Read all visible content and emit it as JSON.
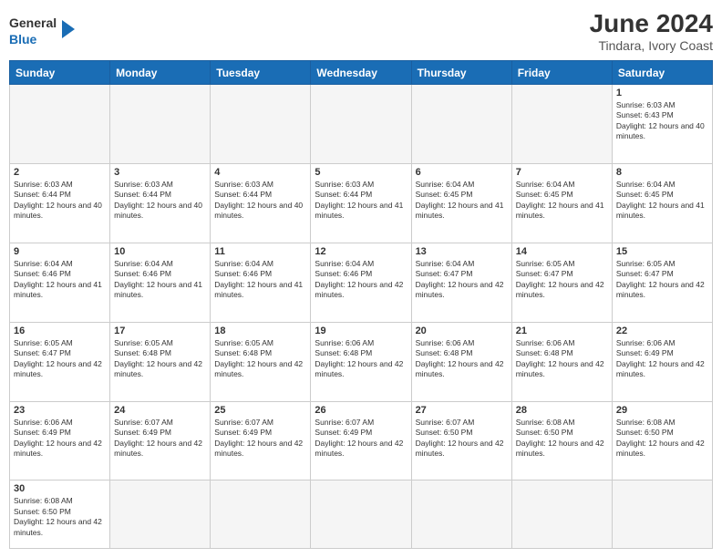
{
  "header": {
    "logo_general": "General",
    "logo_blue": "Blue",
    "month_year": "June 2024",
    "location": "Tindara, Ivory Coast"
  },
  "days_of_week": [
    "Sunday",
    "Monday",
    "Tuesday",
    "Wednesday",
    "Thursday",
    "Friday",
    "Saturday"
  ],
  "weeks": [
    [
      {
        "day": "",
        "empty": true
      },
      {
        "day": "",
        "empty": true
      },
      {
        "day": "",
        "empty": true
      },
      {
        "day": "",
        "empty": true
      },
      {
        "day": "",
        "empty": true
      },
      {
        "day": "",
        "empty": true
      },
      {
        "day": "1",
        "sunrise": "6:03 AM",
        "sunset": "6:43 PM",
        "daylight": "12 hours and 40 minutes."
      }
    ],
    [
      {
        "day": "2",
        "sunrise": "6:03 AM",
        "sunset": "6:44 PM",
        "daylight": "12 hours and 40 minutes."
      },
      {
        "day": "3",
        "sunrise": "6:03 AM",
        "sunset": "6:44 PM",
        "daylight": "12 hours and 40 minutes."
      },
      {
        "day": "4",
        "sunrise": "6:03 AM",
        "sunset": "6:44 PM",
        "daylight": "12 hours and 40 minutes."
      },
      {
        "day": "5",
        "sunrise": "6:03 AM",
        "sunset": "6:44 PM",
        "daylight": "12 hours and 41 minutes."
      },
      {
        "day": "6",
        "sunrise": "6:04 AM",
        "sunset": "6:45 PM",
        "daylight": "12 hours and 41 minutes."
      },
      {
        "day": "7",
        "sunrise": "6:04 AM",
        "sunset": "6:45 PM",
        "daylight": "12 hours and 41 minutes."
      },
      {
        "day": "8",
        "sunrise": "6:04 AM",
        "sunset": "6:45 PM",
        "daylight": "12 hours and 41 minutes."
      }
    ],
    [
      {
        "day": "9",
        "sunrise": "6:04 AM",
        "sunset": "6:46 PM",
        "daylight": "12 hours and 41 minutes."
      },
      {
        "day": "10",
        "sunrise": "6:04 AM",
        "sunset": "6:46 PM",
        "daylight": "12 hours and 41 minutes."
      },
      {
        "day": "11",
        "sunrise": "6:04 AM",
        "sunset": "6:46 PM",
        "daylight": "12 hours and 41 minutes."
      },
      {
        "day": "12",
        "sunrise": "6:04 AM",
        "sunset": "6:46 PM",
        "daylight": "12 hours and 42 minutes."
      },
      {
        "day": "13",
        "sunrise": "6:04 AM",
        "sunset": "6:47 PM",
        "daylight": "12 hours and 42 minutes."
      },
      {
        "day": "14",
        "sunrise": "6:05 AM",
        "sunset": "6:47 PM",
        "daylight": "12 hours and 42 minutes."
      },
      {
        "day": "15",
        "sunrise": "6:05 AM",
        "sunset": "6:47 PM",
        "daylight": "12 hours and 42 minutes."
      }
    ],
    [
      {
        "day": "16",
        "sunrise": "6:05 AM",
        "sunset": "6:47 PM",
        "daylight": "12 hours and 42 minutes."
      },
      {
        "day": "17",
        "sunrise": "6:05 AM",
        "sunset": "6:48 PM",
        "daylight": "12 hours and 42 minutes."
      },
      {
        "day": "18",
        "sunrise": "6:05 AM",
        "sunset": "6:48 PM",
        "daylight": "12 hours and 42 minutes."
      },
      {
        "day": "19",
        "sunrise": "6:06 AM",
        "sunset": "6:48 PM",
        "daylight": "12 hours and 42 minutes."
      },
      {
        "day": "20",
        "sunrise": "6:06 AM",
        "sunset": "6:48 PM",
        "daylight": "12 hours and 42 minutes."
      },
      {
        "day": "21",
        "sunrise": "6:06 AM",
        "sunset": "6:48 PM",
        "daylight": "12 hours and 42 minutes."
      },
      {
        "day": "22",
        "sunrise": "6:06 AM",
        "sunset": "6:49 PM",
        "daylight": "12 hours and 42 minutes."
      }
    ],
    [
      {
        "day": "23",
        "sunrise": "6:06 AM",
        "sunset": "6:49 PM",
        "daylight": "12 hours and 42 minutes."
      },
      {
        "day": "24",
        "sunrise": "6:07 AM",
        "sunset": "6:49 PM",
        "daylight": "12 hours and 42 minutes."
      },
      {
        "day": "25",
        "sunrise": "6:07 AM",
        "sunset": "6:49 PM",
        "daylight": "12 hours and 42 minutes."
      },
      {
        "day": "26",
        "sunrise": "6:07 AM",
        "sunset": "6:49 PM",
        "daylight": "12 hours and 42 minutes."
      },
      {
        "day": "27",
        "sunrise": "6:07 AM",
        "sunset": "6:50 PM",
        "daylight": "12 hours and 42 minutes."
      },
      {
        "day": "28",
        "sunrise": "6:08 AM",
        "sunset": "6:50 PM",
        "daylight": "12 hours and 42 minutes."
      },
      {
        "day": "29",
        "sunrise": "6:08 AM",
        "sunset": "6:50 PM",
        "daylight": "12 hours and 42 minutes."
      }
    ],
    [
      {
        "day": "30",
        "sunrise": "6:08 AM",
        "sunset": "6:50 PM",
        "daylight": "12 hours and 42 minutes."
      },
      {
        "day": "",
        "empty": true
      },
      {
        "day": "",
        "empty": true
      },
      {
        "day": "",
        "empty": true
      },
      {
        "day": "",
        "empty": true
      },
      {
        "day": "",
        "empty": true
      },
      {
        "day": "",
        "empty": true
      }
    ]
  ]
}
